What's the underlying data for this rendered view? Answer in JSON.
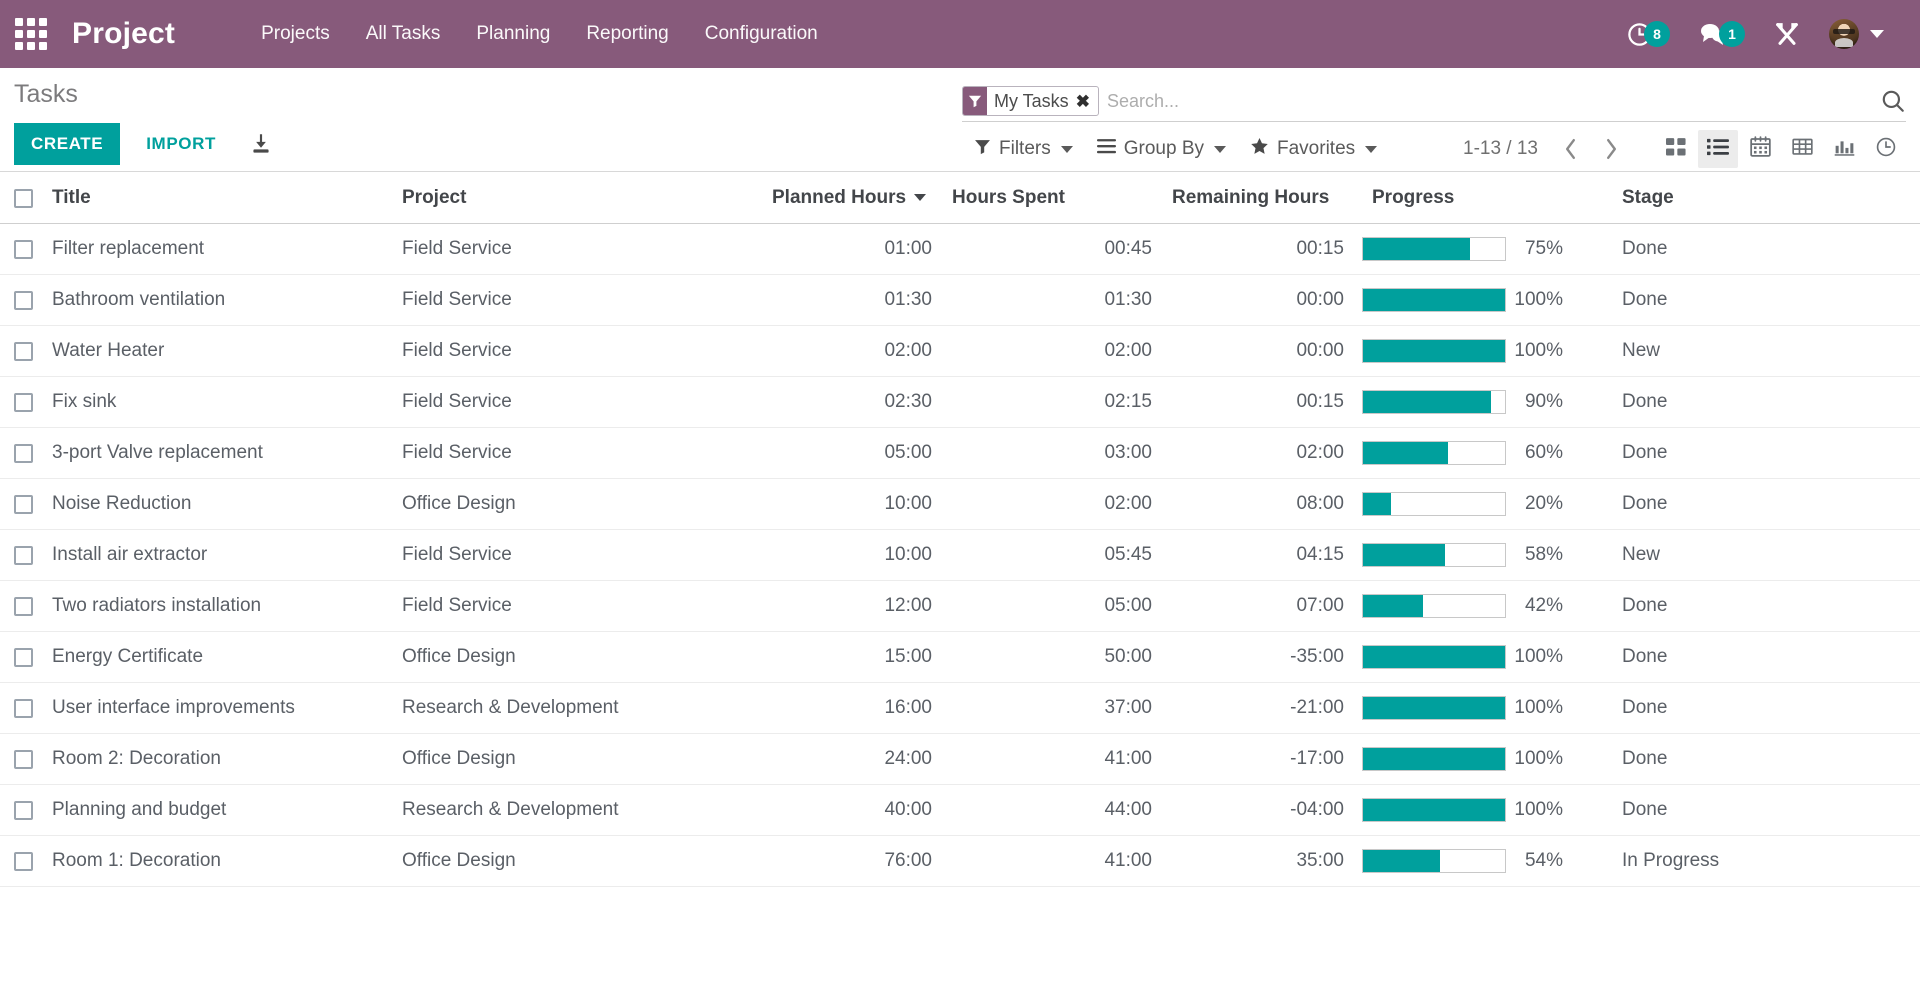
{
  "navbar": {
    "apps_icon": "apps-grid-icon",
    "brand": "Project",
    "menu": [
      {
        "label": "Projects"
      },
      {
        "label": "All Tasks"
      },
      {
        "label": "Planning"
      },
      {
        "label": "Reporting"
      },
      {
        "label": "Configuration"
      }
    ],
    "systray": {
      "activities_icon": "clock-activity-icon",
      "activities_count": "8",
      "messages_icon": "chat-bubble-icon",
      "messages_count": "1",
      "debug_icon": "wrench-screwdriver-icon",
      "avatar_icon": "user-avatar",
      "user_caret_icon": "chevron-down-icon"
    },
    "accent_color": "#875A7B",
    "badge_color": "#00A09D"
  },
  "control_panel": {
    "breadcrumb": "Tasks",
    "create_label": "CREATE",
    "import_label": "IMPORT",
    "export_icon": "download-export-icon",
    "search": {
      "facet_icon": "filter-funnel-icon",
      "facet_label": "My Tasks",
      "facet_remove_icon": "close-x-icon",
      "value": "",
      "placeholder": "Search...",
      "search_icon": "magnifier-icon"
    },
    "tools": [
      {
        "label": "Filters",
        "icon": "filter-funnel-icon"
      },
      {
        "label": "Group By",
        "icon": "hamburger-lines-icon"
      },
      {
        "label": "Favorites",
        "icon": "star-icon"
      }
    ],
    "pager": {
      "count": "1-13 / 13",
      "prev_icon": "chevron-left-icon",
      "next_icon": "chevron-right-icon"
    },
    "views": [
      {
        "name": "kanban",
        "icon": "kanban-squares-icon",
        "active": false
      },
      {
        "name": "list",
        "icon": "list-lines-icon",
        "active": true
      },
      {
        "name": "calendar",
        "icon": "calendar-icon",
        "active": false
      },
      {
        "name": "pivot",
        "icon": "pivot-table-icon",
        "active": false
      },
      {
        "name": "graph",
        "icon": "bar-chart-icon",
        "active": false
      },
      {
        "name": "activity",
        "icon": "clock-icon",
        "active": false
      }
    ]
  },
  "table": {
    "select_all_icon": "checkbox-icon",
    "columns": [
      {
        "label": "Title"
      },
      {
        "label": "Project"
      },
      {
        "label": "Planned Hours",
        "sorted": "desc"
      },
      {
        "label": "Hours Spent"
      },
      {
        "label": "Remaining Hours"
      },
      {
        "label": "Progress"
      },
      {
        "label": "Stage"
      }
    ],
    "rows": [
      {
        "title": "Filter replacement",
        "project": "Field Service",
        "planned": "01:00",
        "spent": "00:45",
        "remaining": "00:15",
        "progress_pct": 75,
        "progress_label": "75%",
        "stage": "Done"
      },
      {
        "title": "Bathroom ventilation",
        "project": "Field Service",
        "planned": "01:30",
        "spent": "01:30",
        "remaining": "00:00",
        "progress_pct": 100,
        "progress_label": "100%",
        "stage": "Done"
      },
      {
        "title": "Water Heater",
        "project": "Field Service",
        "planned": "02:00",
        "spent": "02:00",
        "remaining": "00:00",
        "progress_pct": 100,
        "progress_label": "100%",
        "stage": "New"
      },
      {
        "title": "Fix sink",
        "project": "Field Service",
        "planned": "02:30",
        "spent": "02:15",
        "remaining": "00:15",
        "progress_pct": 90,
        "progress_label": "90%",
        "stage": "Done"
      },
      {
        "title": "3-port Valve replacement",
        "project": "Field Service",
        "planned": "05:00",
        "spent": "03:00",
        "remaining": "02:00",
        "progress_pct": 60,
        "progress_label": "60%",
        "stage": "Done"
      },
      {
        "title": "Noise Reduction",
        "project": "Office Design",
        "planned": "10:00",
        "spent": "02:00",
        "remaining": "08:00",
        "progress_pct": 20,
        "progress_label": "20%",
        "stage": "Done"
      },
      {
        "title": "Install air extractor",
        "project": "Field Service",
        "planned": "10:00",
        "spent": "05:45",
        "remaining": "04:15",
        "progress_pct": 58,
        "progress_label": "58%",
        "stage": "New"
      },
      {
        "title": "Two radiators installation",
        "project": "Field Service",
        "planned": "12:00",
        "spent": "05:00",
        "remaining": "07:00",
        "progress_pct": 42,
        "progress_label": "42%",
        "stage": "Done"
      },
      {
        "title": "Energy Certificate",
        "project": "Office Design",
        "planned": "15:00",
        "spent": "50:00",
        "remaining": "-35:00",
        "progress_pct": 100,
        "progress_label": "100%",
        "stage": "Done"
      },
      {
        "title": "User interface improvements",
        "project": "Research & Development",
        "planned": "16:00",
        "spent": "37:00",
        "remaining": "-21:00",
        "progress_pct": 100,
        "progress_label": "100%",
        "stage": "Done"
      },
      {
        "title": "Room 2: Decoration",
        "project": "Office Design",
        "planned": "24:00",
        "spent": "41:00",
        "remaining": "-17:00",
        "progress_pct": 100,
        "progress_label": "100%",
        "stage": "Done"
      },
      {
        "title": "Planning and budget",
        "project": "Research & Development",
        "planned": "40:00",
        "spent": "44:00",
        "remaining": "-04:00",
        "progress_pct": 100,
        "progress_label": "100%",
        "stage": "Done"
      },
      {
        "title": "Room 1: Decoration",
        "project": "Office Design",
        "planned": "76:00",
        "spent": "41:00",
        "remaining": "35:00",
        "progress_pct": 54,
        "progress_label": "54%",
        "stage": "In Progress"
      }
    ]
  },
  "colors": {
    "brand_purple": "#875A7B",
    "accent_teal": "#00A09D",
    "text": "#5a5f66"
  }
}
